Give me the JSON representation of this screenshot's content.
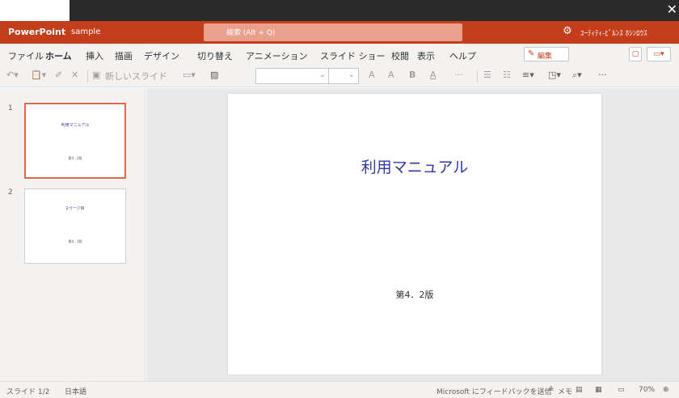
{
  "window": {
    "close_glyph": "✕"
  },
  "titlebar": {
    "app_name": "PowerPoint",
    "doc_name": "sample",
    "search_placeholder": "検索 (Alt + Q)",
    "settings_icon": "gear-icon",
    "user_name": "ﾕｰﾃｨﾃｨ-ﾋﾞﾙﾝｽ ﾎｼﾝﾛｳｽ"
  },
  "menu": {
    "tabs": [
      "ファイル",
      "ホーム",
      "挿入",
      "描画",
      "デザイン",
      "切り替え",
      "アニメーション",
      "スライド ショー",
      "校閲",
      "表示",
      "ヘルプ"
    ],
    "active_tab": "ホーム",
    "edit_label": "編集"
  },
  "toolbar": {
    "new_slide_label": "新しいスライド",
    "font_grow": "A",
    "font_shrink": "A",
    "bold": "B",
    "font_color": "A",
    "more": "···"
  },
  "thumbnails": [
    {
      "number": "1",
      "title": "利用マニュアル",
      "subtitle": "第4．2版",
      "selected": true
    },
    {
      "number": "2",
      "title": "2ページ目",
      "subtitle": "第4．2版",
      "selected": false
    }
  ],
  "slide": {
    "title": "利用マニュアル",
    "subtitle": "第4．2版"
  },
  "status": {
    "slide_info": "スライド 1/2",
    "language": "日本語",
    "feedback": "Microsoft にフィードバックを送信",
    "notes": "メモ",
    "zoom": "70%"
  },
  "colors": {
    "accent": "#c43e1c",
    "title_text": "#2f3b9e",
    "selection_border": "#e0674a"
  }
}
